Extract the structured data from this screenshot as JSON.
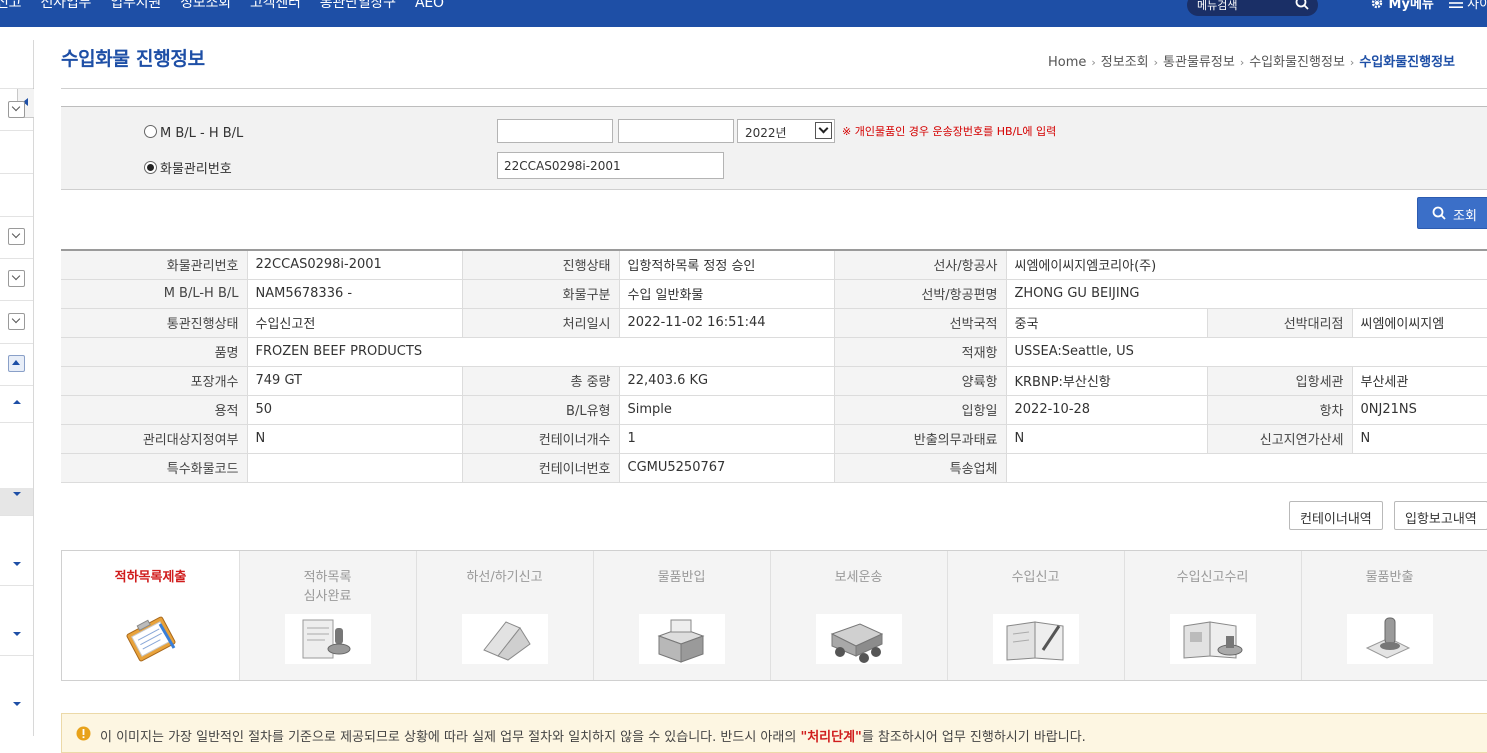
{
  "nav": {
    "items": [
      "신고",
      "선사업무",
      "업무지원",
      "정보조회",
      "고객센터",
      "통관단일창구",
      "AEO"
    ],
    "search_placeholder": "메뉴검색",
    "mymenu_label": "My메뉴",
    "sitemap_label": "사이"
  },
  "page": {
    "title": "수입화물 진행정보",
    "breadcrumb": [
      "Home",
      "정보조회",
      "통관물류정보",
      "수입화물진행정보",
      "수입화물진행정보"
    ]
  },
  "search": {
    "option_bl_label": "M B/L - H B/L",
    "option_cargo_label": "화물관리번호",
    "selected_option": "화물관리번호",
    "mbl_value": "",
    "hbl_value": "",
    "year_selected": "2022년",
    "notice": "※ 개인물품인 경우 운송장번호를 HB/L에 입력",
    "cargo_no_value": "22CCAS0298i-2001",
    "query_label": "조회"
  },
  "info_table": [
    [
      {
        "label": "화물관리번호",
        "value": "22CCAS0298i-2001"
      },
      {
        "label": "진행상태",
        "value": "입항적하목록 정정 승인"
      },
      {
        "label": "선사/항공사",
        "value": "씨엠에이씨지엠코리아(주)",
        "span": true
      }
    ],
    [
      {
        "label": "M B/L-H B/L",
        "value": "NAM5678336 -"
      },
      {
        "label": "화물구분",
        "value": "수입 일반화물"
      },
      {
        "label": "선박/항공편명",
        "value": "ZHONG GU BEIJING",
        "span": true
      }
    ],
    [
      {
        "label": "통관진행상태",
        "value": "수입신고전"
      },
      {
        "label": "처리일시",
        "value": "2022-11-02 16:51:44"
      },
      {
        "label": "선박국적",
        "value": "중국"
      },
      {
        "label": "선박대리점",
        "value": "씨엠에이씨지엠"
      }
    ],
    [
      {
        "label": "품명",
        "value": "FROZEN BEEF PRODUCTS",
        "wide": true
      },
      {
        "label": "적재항",
        "value": "USSEA:Seattle, US",
        "span": true
      }
    ],
    [
      {
        "label": "포장개수",
        "value": "749 GT"
      },
      {
        "label": "총 중량",
        "value": "22,403.6 KG"
      },
      {
        "label": "양륙항",
        "value": "KRBNP:부산신항"
      },
      {
        "label": "입항세관",
        "value": "부산세관"
      }
    ],
    [
      {
        "label": "용적",
        "value": "50"
      },
      {
        "label": "B/L유형",
        "value": "Simple"
      },
      {
        "label": "입항일",
        "value": "2022-10-28"
      },
      {
        "label": "항차",
        "value": "0NJ21NS"
      }
    ],
    [
      {
        "label": "관리대상지정여부",
        "value": "N"
      },
      {
        "label": "컨테이너개수",
        "value": "1"
      },
      {
        "label": "반출의무과태료",
        "value": "N"
      },
      {
        "label": "신고지연가산세",
        "value": "N"
      }
    ],
    [
      {
        "label": "특수화물코드",
        "value": ""
      },
      {
        "label": "컨테이너번호",
        "value": "CGMU5250767"
      },
      {
        "label": "특송업체",
        "value": "",
        "span": true
      }
    ]
  ],
  "actions": {
    "container_list_label": "컨테이너내역",
    "arrival_report_label": "입항보고내역"
  },
  "steps": [
    {
      "label": "적하목록제출",
      "icon": "clipboard-icon",
      "active": true
    },
    {
      "label": "적하목록\n심사완료",
      "icon": "stamp-icon",
      "active": false
    },
    {
      "label": "하선/하기신고",
      "icon": "laptop-icon",
      "active": false
    },
    {
      "label": "물품반입",
      "icon": "boxes-icon",
      "active": false
    },
    {
      "label": "보세운송",
      "icon": "truck-icon",
      "active": false
    },
    {
      "label": "수입신고",
      "icon": "document-pen-icon",
      "active": false
    },
    {
      "label": "수입신고수리",
      "icon": "approval-book-icon",
      "active": false
    },
    {
      "label": "물품반출",
      "icon": "release-stamp-icon",
      "active": false
    }
  ],
  "note": {
    "text_before": "이 이미지는 가장 일반적인 절차를 기준으로 제공되므로 상황에 따라 실제 업무 절차와 일치하지 않을 수 있습니다. 반드시 아래의 ",
    "highlight": "\"처리단계\"",
    "text_after": "를 참조하시어 업무 진행하시기 바랍니다."
  },
  "colors": {
    "nav_bg": "#1e4fa6",
    "title_blue": "#1e4fa6",
    "button_blue": "#3b6fc8",
    "notice_red": "#d40000",
    "active_step_red": "#d01c1c"
  }
}
